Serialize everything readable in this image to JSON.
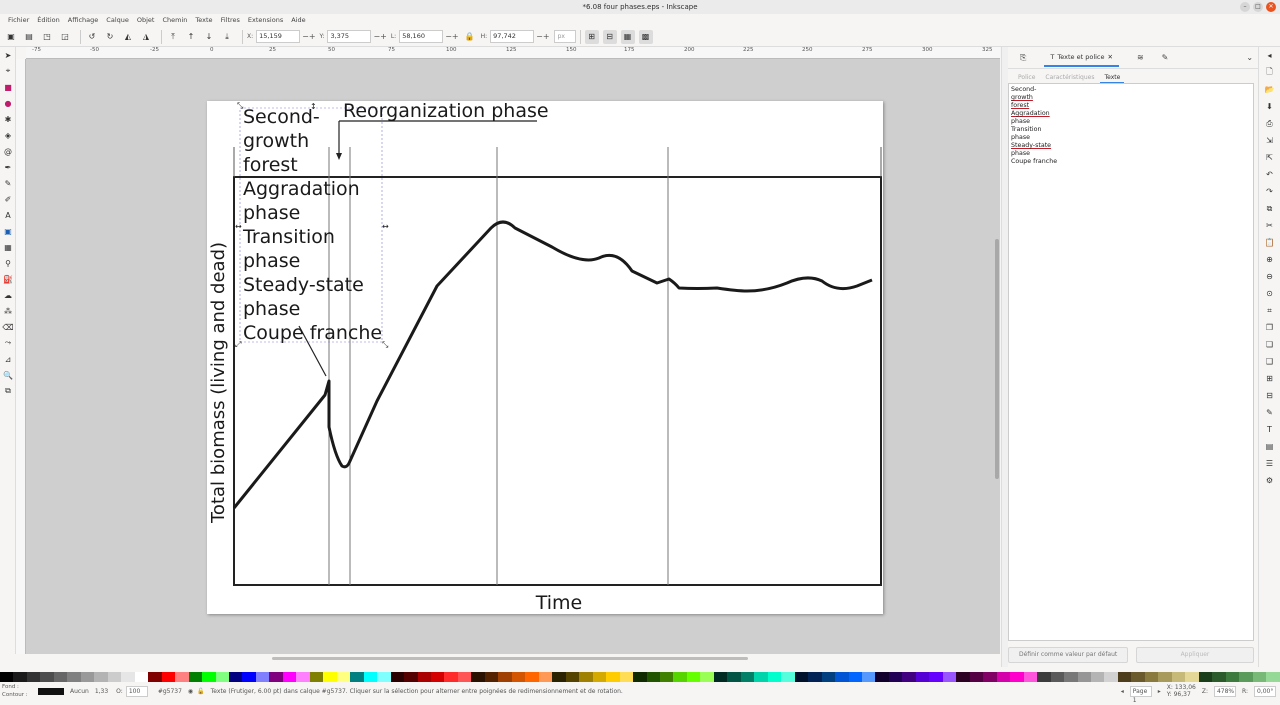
{
  "window": {
    "title": "*6.08 four phases.eps - Inkscape"
  },
  "menu": [
    "Fichier",
    "Édition",
    "Affichage",
    "Calque",
    "Objet",
    "Chemin",
    "Texte",
    "Filtres",
    "Extensions",
    "Aide"
  ],
  "toolbar": {
    "x_label": "X:",
    "x_value": "15,159",
    "y_label": "Y:",
    "y_value": "3,375",
    "w_label": "L:",
    "w_value": "58,160",
    "h_label": "H:",
    "h_value": "97,742",
    "unit": "px"
  },
  "ruler": {
    "labels": [
      "-75",
      "-50",
      "-25",
      "0",
      "25",
      "50",
      "75",
      "100",
      "125",
      "150",
      "175",
      "200",
      "225",
      "250",
      "275",
      "300",
      "325"
    ]
  },
  "drawing": {
    "phase_list": [
      "Second-",
      "growth",
      "forest",
      "Aggradation",
      "phase",
      "Transition",
      "phase",
      "Steady-state",
      "phase",
      "Coupe franche"
    ],
    "reorg_label": "Reorganization phase",
    "ylabel": "Total biomass (living and dead)",
    "xlabel": "Time"
  },
  "panel": {
    "tab_title": "Texte et police",
    "subtabs": [
      "Police",
      "Caractéristiques",
      "Texte"
    ],
    "text_lines": [
      {
        "t": "Second-",
        "err": false
      },
      {
        "t": "growth",
        "err": true
      },
      {
        "t": "forest",
        "err": true
      },
      {
        "t": "Aggradation",
        "err": true
      },
      {
        "t": "phase",
        "err": false
      },
      {
        "t": "Transition",
        "err": false
      },
      {
        "t": "phase",
        "err": false
      },
      {
        "t": "Steady-state",
        "err": true
      },
      {
        "t": "phase",
        "err": false
      },
      {
        "t": "Coupe franche",
        "err": false
      }
    ],
    "default_button": "Définir comme valeur par défaut",
    "apply_button": "Appliquer"
  },
  "status": {
    "fill_label": "Fond :",
    "stroke_label": "Contour :",
    "stroke_value": "Aucun",
    "stroke_width": "1,33",
    "opacity_label": "O:",
    "opacity_value": "100",
    "layer": "#g5737",
    "message": "Texte  (Frutiger, 6.00 pt) dans calque #g5737. Cliquer sur la sélection pour alterner entre poignées de redimensionnement et de rotation.",
    "page": "Page 1",
    "cursor_x": "X: 133,06",
    "cursor_y": "Y: 96,37",
    "zoom_label": "Z:",
    "zoom": "478%",
    "rotate_label": "R:",
    "rotate": "0,00°"
  },
  "colors": {
    "accent": "#3584e4",
    "close": "#e95420",
    "canvas": "#cfcfcf"
  }
}
